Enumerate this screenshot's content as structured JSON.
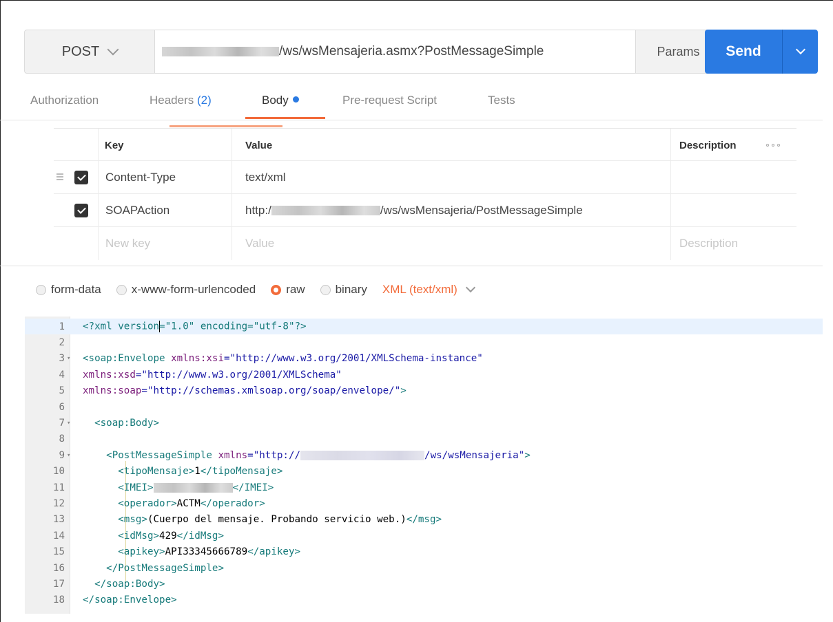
{
  "request": {
    "method": "POST",
    "url_suffix": "/ws/wsMensajeria.asmx?PostMessageSimple",
    "params_label": "Params",
    "send_label": "Send"
  },
  "tabs": {
    "authorization": "Authorization",
    "headers": "Headers",
    "headers_count": "(2)",
    "body": "Body",
    "prerequest": "Pre-request Script",
    "tests": "Tests"
  },
  "headers_table": {
    "columns": {
      "key": "Key",
      "value": "Value",
      "description": "Description"
    },
    "rows": [
      {
        "key": "Content-Type",
        "value": "text/xml",
        "checked": true
      },
      {
        "key": "SOAPAction",
        "value_prefix": "http:/",
        "value_suffix": "/ws/wsMensajeria/PostMessageSimple",
        "checked": true
      }
    ],
    "new_row": {
      "key": "New key",
      "value": "Value",
      "description": "Description"
    }
  },
  "body_types": {
    "form_data": "form-data",
    "urlencoded": "x-www-form-urlencoded",
    "raw": "raw",
    "binary": "binary",
    "selected": "raw",
    "content_type": "XML (text/xml)"
  },
  "editor": {
    "lines": [
      {
        "n": "1",
        "fold": ""
      },
      {
        "n": "2",
        "fold": ""
      },
      {
        "n": "3",
        "fold": "▾"
      },
      {
        "n": "4",
        "fold": ""
      },
      {
        "n": "5",
        "fold": ""
      },
      {
        "n": "6",
        "fold": ""
      },
      {
        "n": "7",
        "fold": "▾"
      },
      {
        "n": "8",
        "fold": ""
      },
      {
        "n": "9",
        "fold": "▾"
      },
      {
        "n": "10",
        "fold": ""
      },
      {
        "n": "11",
        "fold": ""
      },
      {
        "n": "12",
        "fold": ""
      },
      {
        "n": "13",
        "fold": ""
      },
      {
        "n": "14",
        "fold": ""
      },
      {
        "n": "15",
        "fold": ""
      },
      {
        "n": "16",
        "fold": ""
      },
      {
        "n": "17",
        "fold": ""
      },
      {
        "n": "18",
        "fold": ""
      }
    ],
    "t": {
      "l1a": "<?xml version",
      "l1b": "=\"1.0\" encoding=\"utf-8\"?>",
      "l3_tag": "<soap:Envelope",
      "l3_attr": " xmlns:xsi",
      "l3_val": "=\"http://www.w3.org/2001/XMLSchema-instance\"",
      "l4_attr": "xmlns:xsd",
      "l4_val": "=\"http://www.w3.org/2001/XMLSchema\"",
      "l5_attr": "xmlns:soap",
      "l5_val": "=\"http://schemas.xmlsoap.org/soap/envelope/\"",
      "l5_end": ">",
      "l7": "<soap:Body>",
      "l9_tag": "<PostMessageSimple",
      "l9_attr": " xmlns",
      "l9_val1": "=\"http://",
      "l9_val2": "/ws/wsMensajeria\"",
      "l9_end": ">",
      "l10_open": "<tipoMensaje>",
      "l10_text": "1",
      "l10_close": "</tipoMensaje>",
      "l11_open": "<IMEI>",
      "l11_close": "</IMEI>",
      "l12_open": "<operador>",
      "l12_text": "ACTM",
      "l12_close": "</operador>",
      "l13_open": "<msg>",
      "l13_text": "(Cuerpo del mensaje. Probando servicio web.)",
      "l13_close": "</msg>",
      "l14_open": "<idMsg>",
      "l14_text": "429",
      "l14_close": "</idMsg>",
      "l15_open": "<apikey>",
      "l15_text": "API33345666789",
      "l15_close": "</apikey>",
      "l16": "</PostMessageSimple>",
      "l17": "</soap:Body>",
      "l18": "</soap:Envelope>"
    }
  },
  "colors": {
    "send_button": "#2a7ae2",
    "active_tab_underline": "#f26b3a",
    "content_type_selector": "#f26b3a",
    "xml_tag": "#167a7a",
    "xml_attr": "#7b1e7b",
    "xml_string": "#1a1aa6"
  }
}
